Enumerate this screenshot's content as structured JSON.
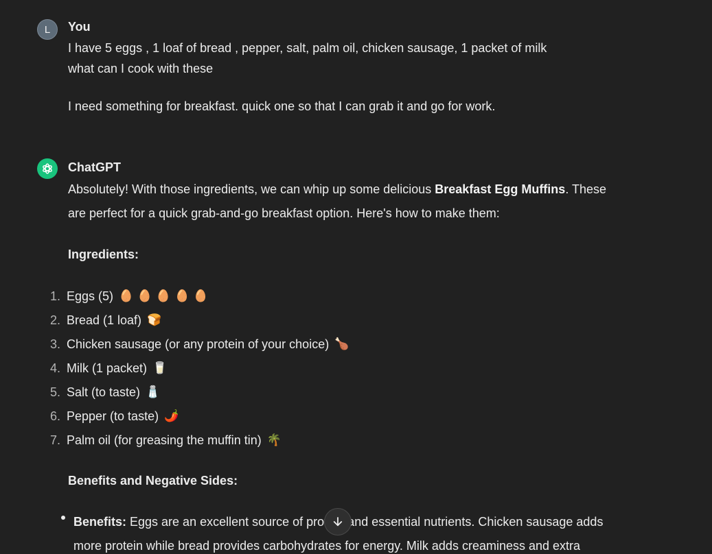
{
  "user_message": {
    "avatar_letter": "L",
    "author": "You",
    "lines": [
      "I have 5 eggs , 1 loaf of bread , pepper, salt, palm oil, chicken sausage, 1 packet of milk",
      "what can I cook with these",
      "I need something for breakfast. quick one so that I can grab it and go for work."
    ]
  },
  "assistant_message": {
    "author": "ChatGPT",
    "intro_line1_before": "Absolutely! With those ingredients, we can whip up some delicious ",
    "intro_line1_bold": "Breakfast Egg Muffins",
    "intro_line1_after": ". These",
    "intro_line2": "are perfect for a quick grab-and-go breakfast option. Here's how to make them:",
    "ingredients_heading": "Ingredients:",
    "ingredients": [
      {
        "num": "1.",
        "text": "Eggs (5)",
        "emoji": "🥚🥚🥚🥚🥚"
      },
      {
        "num": "2.",
        "text": "Bread (1 loaf)",
        "emoji": "🍞"
      },
      {
        "num": "3.",
        "text": "Chicken sausage (or any protein of your choice)",
        "emoji": "🍗"
      },
      {
        "num": "4.",
        "text": "Milk (1 packet)",
        "emoji": "🥛"
      },
      {
        "num": "5.",
        "text": "Salt (to taste)",
        "emoji": "🧂"
      },
      {
        "num": "6.",
        "text": "Pepper (to taste)",
        "emoji": "🌶️"
      },
      {
        "num": "7.",
        "text": "Palm oil (for greasing the muffin tin)",
        "emoji": "🌴"
      }
    ],
    "benefits_heading": "Benefits and Negative Sides:",
    "benefits_label": "Benefits:",
    "benefits_line1": " Eggs are an excellent source of protein and essential nutrients. Chicken sausage adds",
    "benefits_line2": "more protein while bread provides carbohydrates for energy. Milk adds creaminess and extra"
  },
  "scroll_button": {
    "icon": "arrow-down-icon"
  },
  "colors": {
    "background": "#212121",
    "text": "#ececec",
    "chatgpt_green": "#19c37d",
    "user_avatar": "#5d6b78"
  }
}
